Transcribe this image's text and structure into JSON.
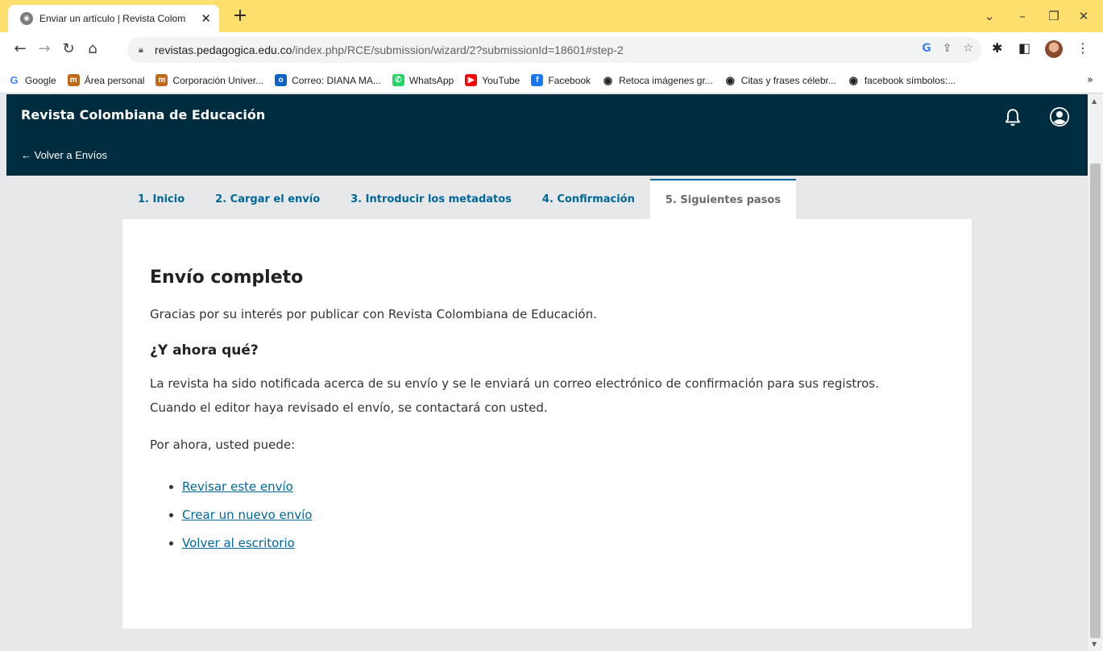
{
  "browser": {
    "tab_title": "Enviar un artículo | Revista Colom",
    "tab_close": "✕",
    "new_tab": "+",
    "url_host": "revistas.pedagogica.edu.co",
    "url_path": "/index.php/RCE/submission/wizard/2?submissionId=18601#step-2",
    "bookmarks": [
      {
        "label": "Google",
        "icon": "google-icon",
        "color": "#4285f4"
      },
      {
        "label": "Área personal",
        "icon": "moodle-icon",
        "color": "#c06a1a"
      },
      {
        "label": "Corporación Univer...",
        "icon": "moodle-icon",
        "color": "#c06a1a"
      },
      {
        "label": "Correo: DIANA MA...",
        "icon": "outlook-icon",
        "color": "#0a64c8"
      },
      {
        "label": "WhatsApp",
        "icon": "whatsapp-icon",
        "color": "#25d366"
      },
      {
        "label": "YouTube",
        "icon": "youtube-icon",
        "color": "#ff0000"
      },
      {
        "label": "Facebook",
        "icon": "facebook-icon",
        "color": "#1877f2"
      },
      {
        "label": "Retoca imágenes gr...",
        "icon": "globe-icon",
        "color": "#202124"
      },
      {
        "label": "Citas y frases célebr...",
        "icon": "globe-icon",
        "color": "#202124"
      },
      {
        "label": "facebook símbolos:...",
        "icon": "globe-icon",
        "color": "#202124"
      }
    ],
    "bookmarks_more": "»"
  },
  "app": {
    "site_title": "Revista Colombiana de Educación",
    "back_link": "← Volver a Envíos",
    "header_bg": "#002c40",
    "accent": "#006798"
  },
  "wizard": {
    "tabs": [
      {
        "label": "1. Inicio",
        "active": false
      },
      {
        "label": "2. Cargar el envío",
        "active": false
      },
      {
        "label": "3. Introducir los metadatos",
        "active": false
      },
      {
        "label": "4. Confirmación",
        "active": false
      },
      {
        "label": "5. Siguientes pasos",
        "active": true
      }
    ]
  },
  "content": {
    "heading": "Envío completo",
    "thanks": "Gracias por su interés por publicar con Revista Colombiana de Educación.",
    "subheading": "¿Y ahora qué?",
    "notice_line1": "La revista ha sido notificada acerca de su envío y se le enviará un correo electrónico de confirmación para sus registros.",
    "notice_line2": "Cuando el editor haya revisado el envío, se contactará con usted.",
    "for_now": "Por ahora, usted puede:",
    "links": [
      {
        "label": "Revisar este envío"
      },
      {
        "label": "Crear un nuevo envío"
      },
      {
        "label": "Volver al escritorio"
      }
    ]
  }
}
